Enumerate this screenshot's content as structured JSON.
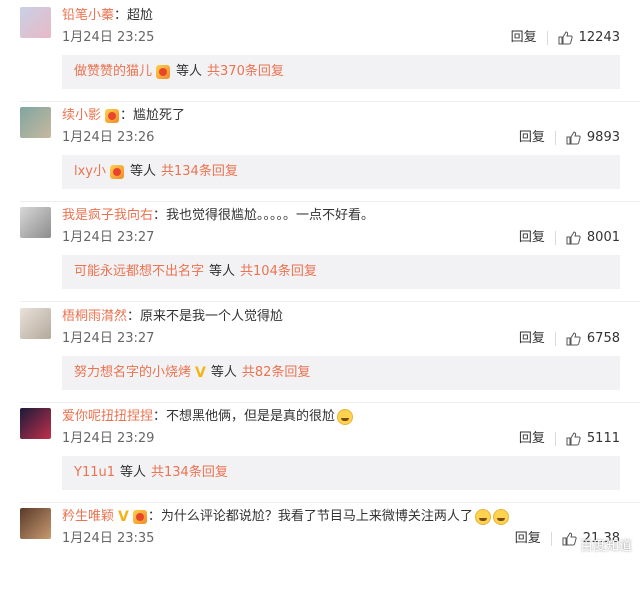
{
  "comments": [
    {
      "user": "铅笔小蓁",
      "vip": false,
      "vtag": "",
      "text": "超尬",
      "emoji": false,
      "time": "1月24日 23:25",
      "reply": "回复",
      "likes": "12243",
      "replies": {
        "name": "做赞赞的猫儿",
        "vip": true,
        "vtag": "",
        "mid": "等人",
        "count": "共370条回复"
      },
      "avatar_colors": [
        "#c8d0e6",
        "#e9b9c6"
      ]
    },
    {
      "user": "续小影",
      "vip": true,
      "vtag": "",
      "text": "尴尬死了",
      "emoji": false,
      "time": "1月24日 23:26",
      "reply": "回复",
      "likes": "9893",
      "replies": {
        "name": "lxy小",
        "vip": true,
        "vtag": "",
        "mid": "等人",
        "count": "共134条回复"
      },
      "avatar_colors": [
        "#7fa6a0",
        "#c8b8a0"
      ]
    },
    {
      "user": "我是疯子我向右",
      "vip": false,
      "vtag": "",
      "text": "我也觉得很尴尬。。。。。一点不好看。",
      "emoji": false,
      "time": "1月24日 23:27",
      "reply": "回复",
      "likes": "8001",
      "replies": {
        "name": "可能永远都想不出名字",
        "vip": false,
        "vtag": "",
        "mid": "等人",
        "count": "共104条回复"
      },
      "avatar_colors": [
        "#d8d8d8",
        "#8c8c8c"
      ]
    },
    {
      "user": "梧桐雨潸然",
      "vip": false,
      "vtag": "",
      "text": "原来不是我一个人觉得尬",
      "emoji": false,
      "time": "1月24日 23:27",
      "reply": "回复",
      "likes": "6758",
      "replies": {
        "name": "努力想名字的小烧烤",
        "vip": false,
        "vtag": "V",
        "mid": "等人",
        "count": "共82条回复"
      },
      "avatar_colors": [
        "#e8e2da",
        "#b5a89a"
      ]
    },
    {
      "user": "爱你呢扭扭捏捏",
      "vip": false,
      "vtag": "",
      "text": "不想黑他俩，但是是真的很尬",
      "emoji": true,
      "time": "1月24日 23:29",
      "reply": "回复",
      "likes": "5111",
      "replies": {
        "name": "Y11u1",
        "vip": false,
        "vtag": "",
        "mid": "等人",
        "count": "共134条回复"
      },
      "avatar_colors": [
        "#1a1a3a",
        "#c0304a"
      ]
    },
    {
      "user": "矜生唯颖",
      "vip": true,
      "vtag": "V",
      "text": "为什么评论都说尬？我看了节目马上来微博关注两人了",
      "emoji": true,
      "time": "1月24日 23:35",
      "reply": "回复",
      "likes": "21.38",
      "replies": null,
      "avatar_colors": [
        "#5a3a2a",
        "#c89a70"
      ]
    }
  ],
  "watermark": "百度知道"
}
